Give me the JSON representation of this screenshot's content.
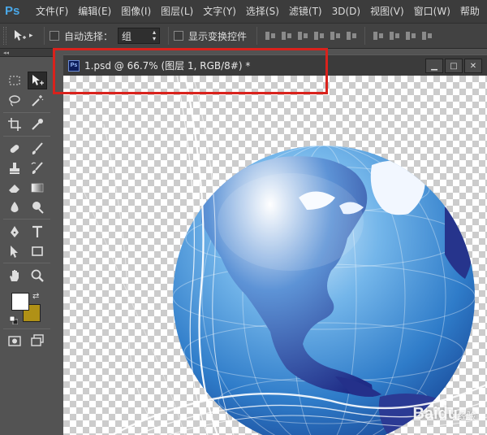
{
  "app": {
    "logo": "Ps"
  },
  "menu": {
    "items": [
      "文件(F)",
      "编辑(E)",
      "图像(I)",
      "图层(L)",
      "文字(Y)",
      "选择(S)",
      "滤镜(T)",
      "3D(D)",
      "视图(V)",
      "窗口(W)",
      "帮助"
    ]
  },
  "options": {
    "tool_preset_arrow": "▸",
    "auto_select_label": "自动选择：",
    "auto_select_value": "组",
    "show_transform_label": "显示变换控件"
  },
  "toolbox": {
    "header": "◂◂"
  },
  "colors": {
    "foreground": "#ffffff",
    "background": "#b09116",
    "highlight": "#d9221c"
  },
  "document": {
    "icon_label": "Ps",
    "title": "1.psd @ 66.7% (图层 1, RGB/8#) *",
    "minimize": "▁",
    "maximize": "□",
    "close": "✕"
  },
  "watermark": {
    "text": "Baidu",
    "sub": "经验"
  }
}
